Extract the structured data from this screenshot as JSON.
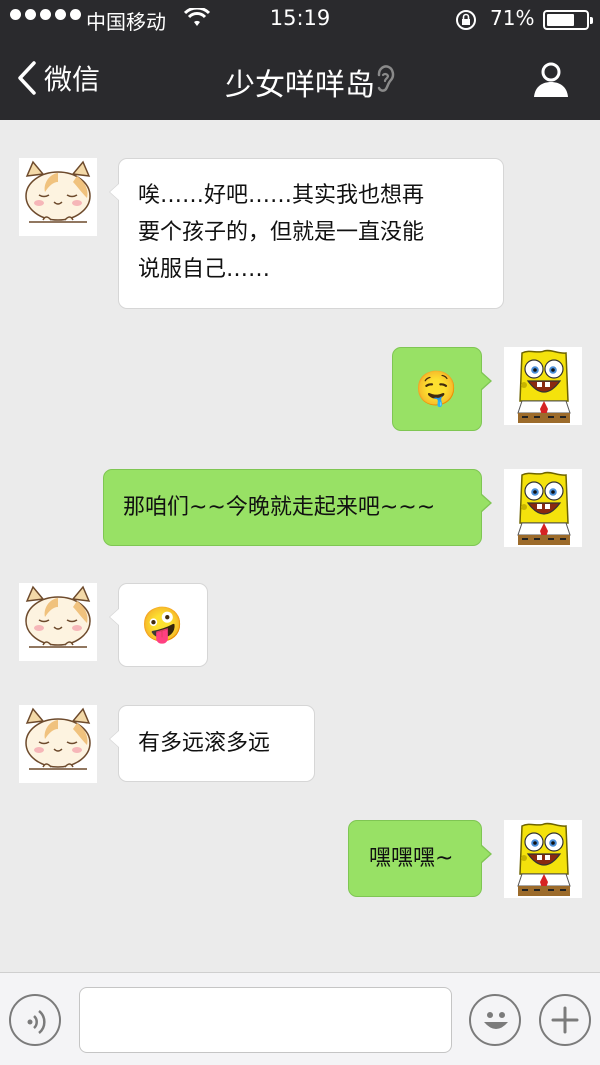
{
  "status_bar": {
    "carrier": "中国移动",
    "time": "15:19",
    "battery_percent": "71%",
    "battery_level": 0.71,
    "signal_dots": 5
  },
  "nav": {
    "back_label": "微信",
    "title": "少女咩咩岛"
  },
  "messages": [
    {
      "side": "left",
      "avatar": "cat-avatar",
      "lines": [
        "唉……好吧……其实我也想再",
        "要个孩子的，但就是一直没能",
        "说服自己……"
      ]
    },
    {
      "side": "right",
      "avatar": "spongebob-avatar",
      "emoji": "🤤"
    },
    {
      "side": "right",
      "avatar": "spongebob-avatar",
      "lines": [
        "那咱们~~今晚就走起来吧~~~"
      ]
    },
    {
      "side": "left",
      "avatar": "cat-avatar",
      "emoji": "🤪"
    },
    {
      "side": "left",
      "avatar": "cat-avatar",
      "lines": [
        "有多远滚多远"
      ]
    },
    {
      "side": "right",
      "avatar": "spongebob-avatar",
      "lines": [
        "嘿嘿嘿~"
      ]
    }
  ],
  "colors": {
    "bar_dark": "#2a2a2d",
    "chat_bg": "#ebebeb",
    "bubble_sent": "#98e165",
    "bubble_received": "#ffffff"
  },
  "input_bar": {
    "voice_icon": "voice-wave-icon",
    "emoji_icon": "smiley-icon",
    "more_icon": "plus-icon",
    "text_value": ""
  }
}
